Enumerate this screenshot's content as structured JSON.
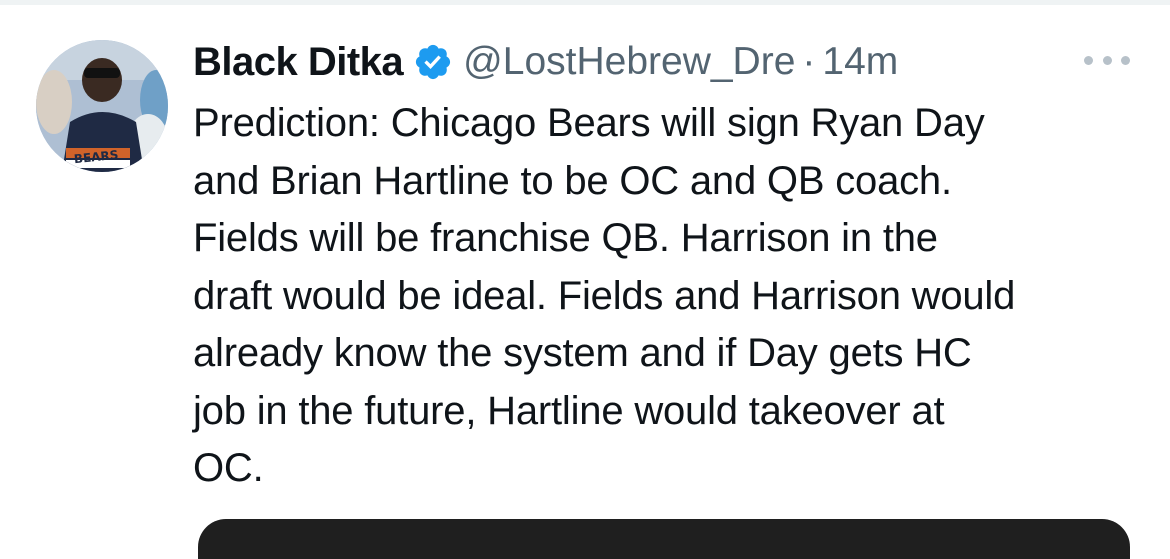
{
  "tweet": {
    "author_name": "Black Ditka",
    "handle": "@LostHebrew_Dre",
    "separator": "·",
    "time": "14m",
    "avatar_text": "BEARS",
    "text_lines": [
      "Prediction: Chicago Bears will sign Ryan Day",
      "and Brian Hartline to be OC and QB coach.",
      "Fields will be franchise QB. Harrison in the",
      "draft would be ideal. Fields and Harrison would",
      "already know the system and if Day gets HC",
      "job in the future, Hartline would takeover at",
      "OC."
    ]
  },
  "icons": {
    "verified": "verified-badge-icon",
    "more": "more-options-icon"
  },
  "colors": {
    "verified_blue": "#1d9bf0",
    "secondary_text": "#536471",
    "primary_text": "#0f1419"
  }
}
